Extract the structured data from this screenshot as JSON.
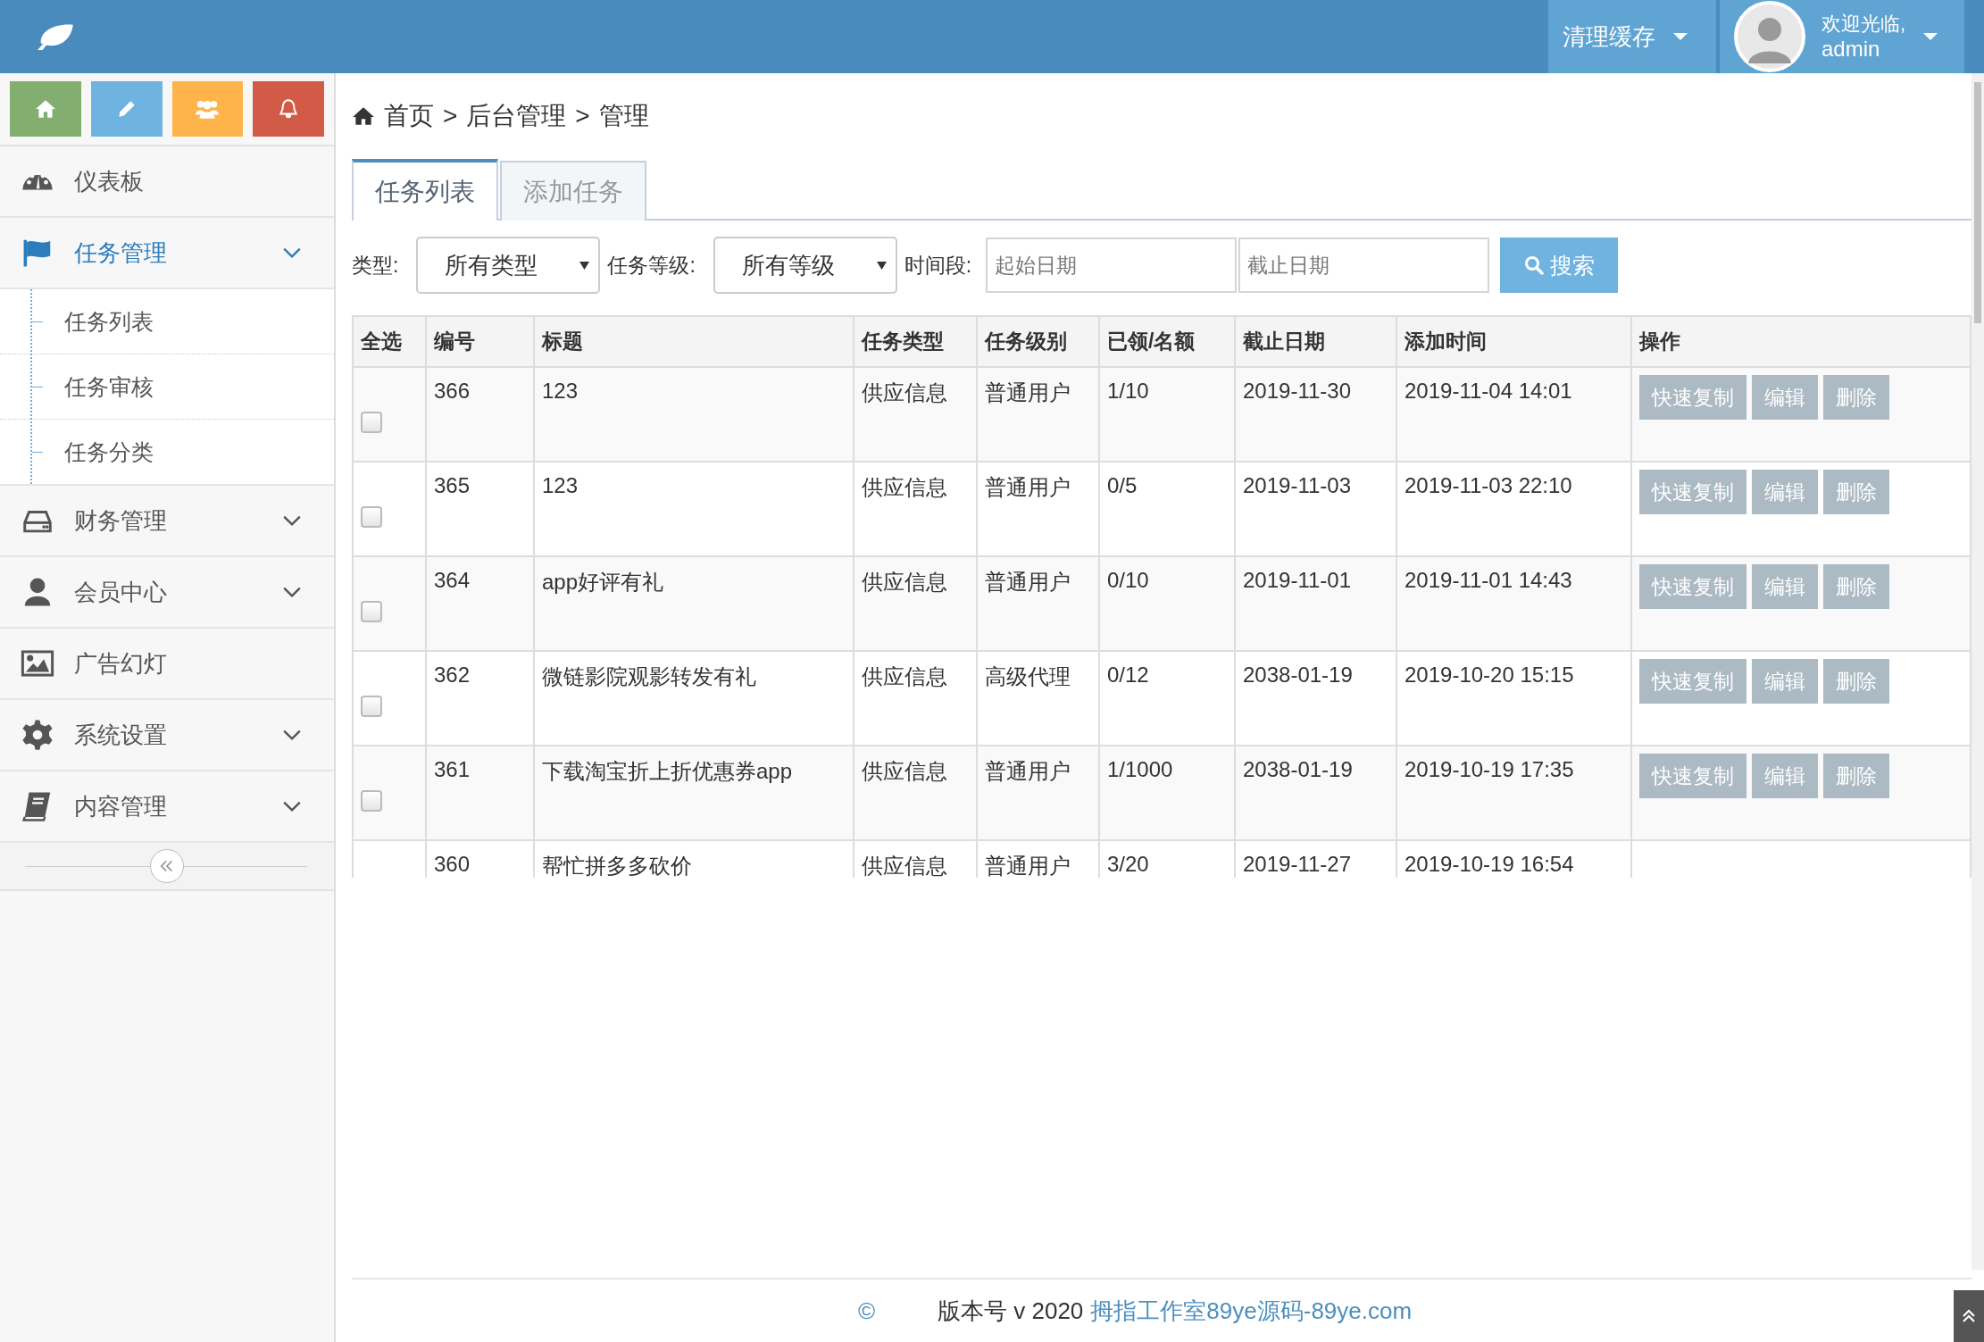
{
  "header": {
    "actions": [
      {
        "label": "清理缓存"
      }
    ],
    "user": {
      "greeting": "欢迎光临,",
      "name": "admin"
    }
  },
  "sidebar": {
    "items": [
      {
        "label": "仪表板",
        "selected": false
      },
      {
        "label": "任务管理",
        "selected": true,
        "expanded": true,
        "children": [
          {
            "label": "任务列表"
          },
          {
            "label": "任务审核"
          },
          {
            "label": "任务分类"
          }
        ]
      },
      {
        "label": "财务管理",
        "selected": false,
        "expanded": false
      },
      {
        "label": "会员中心",
        "selected": false,
        "expanded": false
      },
      {
        "label": "广告幻灯",
        "selected": false
      },
      {
        "label": "系统设置",
        "selected": false,
        "expanded": false
      },
      {
        "label": "内容管理",
        "selected": false,
        "expanded": false
      }
    ]
  },
  "breadcrumb": {
    "separator": ">",
    "items": [
      "首页",
      "后台管理",
      "管理"
    ]
  },
  "tabs": [
    {
      "label": "任务列表",
      "selected": true
    },
    {
      "label": "添加任务",
      "selected": false
    }
  ],
  "filters": {
    "type_label": "类型:",
    "type_value": "所有类型",
    "level_label": "任务等级:",
    "level_value": "所有等级",
    "period_label": "时间段:",
    "start_placeholder": "起始日期",
    "end_placeholder": "截止日期",
    "search_button": "搜索"
  },
  "table": {
    "columns": [
      "全选",
      "编号",
      "标题",
      "任务类型",
      "任务级别",
      "已领/名额",
      "截止日期",
      "添加时间",
      "操作"
    ],
    "rows": [
      {
        "checked": false,
        "cells": [
          "",
          "366",
          "123",
          "供应信息",
          "普通用户",
          "1/10",
          "2019-11-30",
          "2019-11-04 14:01"
        ],
        "actions": [
          "快速复制",
          "编辑",
          "删除"
        ]
      },
      {
        "checked": false,
        "cells": [
          "",
          "365",
          "123",
          "供应信息",
          "普通用户",
          "0/5",
          "2019-11-03",
          "2019-11-03 22:10"
        ],
        "actions": [
          "快速复制",
          "编辑",
          "删除"
        ]
      },
      {
        "checked": false,
        "cells": [
          "",
          "364",
          "app好评有礼",
          "供应信息",
          "普通用户",
          "0/10",
          "2019-11-01",
          "2019-11-01 14:43"
        ],
        "actions": [
          "快速复制",
          "编辑",
          "删除"
        ]
      },
      {
        "checked": false,
        "cells": [
          "",
          "362",
          "微链影院观影转发有礼",
          "供应信息",
          "高级代理",
          "0/12",
          "2038-01-19",
          "2019-10-20 15:15"
        ],
        "actions": [
          "快速复制",
          "编辑",
          "删除"
        ]
      },
      {
        "checked": false,
        "cells": [
          "",
          "361",
          "下载淘宝折上折优惠券app",
          "供应信息",
          "普通用户",
          "1/1000",
          "2038-01-19",
          "2019-10-19 17:35"
        ],
        "actions": [
          "快速复制",
          "编辑",
          "删除"
        ]
      },
      {
        "cells": [
          "",
          "360",
          "帮忙拼多多砍价",
          "供应信息",
          "普通用户",
          "3/20",
          "2019-11-27",
          "2019-10-19 16:54"
        ]
      }
    ]
  },
  "footer": {
    "copyright": "©",
    "version": "版本号 v 2020",
    "link": "拇指工作室89ye源码-89ye.com"
  }
}
